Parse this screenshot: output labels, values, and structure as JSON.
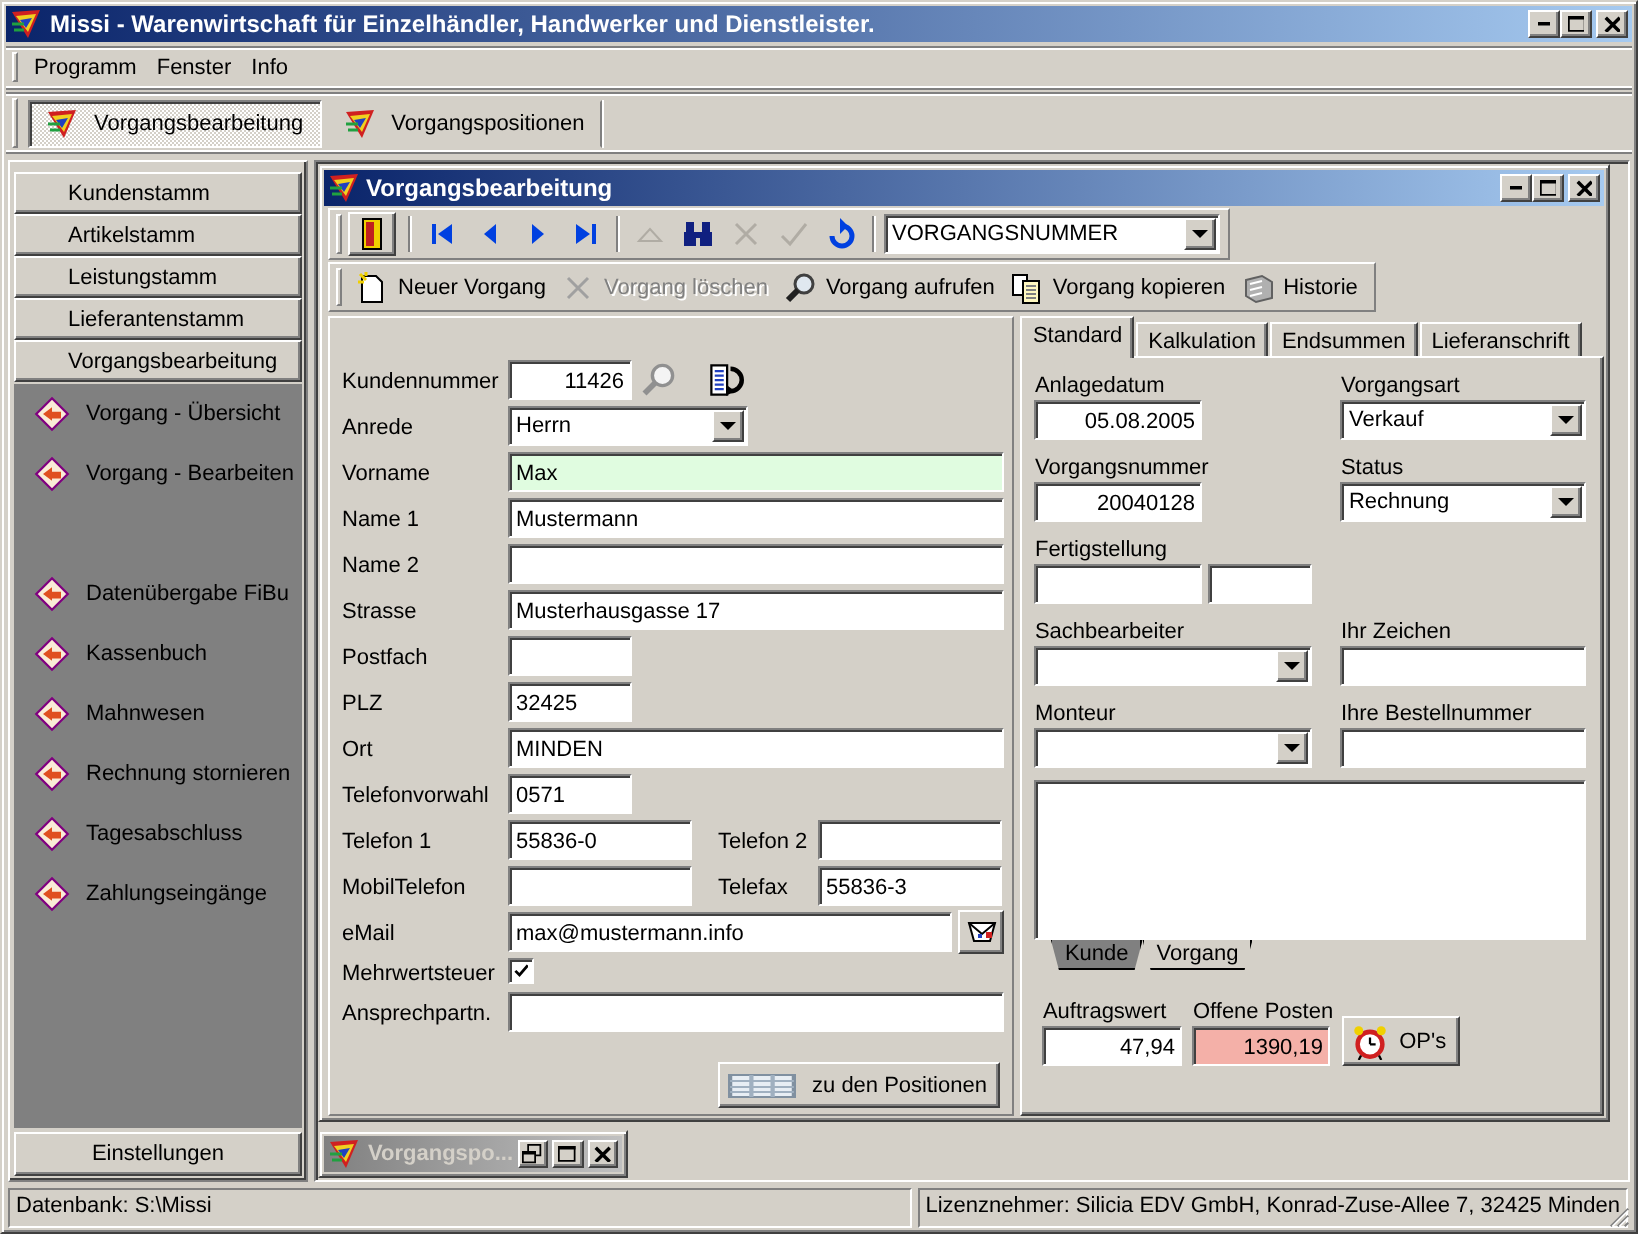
{
  "window": {
    "title": "Missi - Warenwirtschaft für Einzelhändler, Handwerker und Dienstleister."
  },
  "menu": [
    "Programm",
    "Fenster",
    "Info"
  ],
  "toolbar": [
    {
      "label": "Vorgangsbearbeitung",
      "selected": true
    },
    {
      "label": "Vorgangspositionen",
      "selected": false
    }
  ],
  "sidebar": {
    "modules": [
      "Kundenstamm",
      "Artikelstamm",
      "Leistungstamm",
      "Lieferantenstamm",
      "Vorgangsbearbeitung"
    ],
    "task_groups": [
      [
        "Vorgang - Übersicht",
        "Vorgang - Bearbeiten"
      ],
      [
        "Datenübergabe FiBu",
        "Kassenbuch",
        "Mahnwesen",
        "Rechnung stornieren",
        "Tagesabschluss",
        "Zahlungseingänge"
      ]
    ],
    "settings": "Einstellungen"
  },
  "child_window": {
    "title": "Vorgangsbearbeitung",
    "nav_groups": [
      [
        {
          "kind": "exit",
          "disabled": false
        }
      ],
      [
        {
          "kind": "first",
          "disabled": false
        },
        {
          "kind": "prev",
          "disabled": false
        },
        {
          "kind": "next",
          "disabled": false
        },
        {
          "kind": "last",
          "disabled": false
        }
      ],
      [
        {
          "kind": "up",
          "disabled": true
        },
        {
          "kind": "find",
          "disabled": false
        },
        {
          "kind": "cancel",
          "disabled": true
        },
        {
          "kind": "confirm",
          "disabled": true
        },
        {
          "kind": "refresh",
          "disabled": false
        }
      ]
    ],
    "search_field": {
      "value": "VORGANGSNUMMER"
    },
    "actions": [
      {
        "kind": "new",
        "label": "Neuer Vorgang",
        "disabled": false
      },
      {
        "kind": "delete",
        "label": "Vorgang löschen",
        "disabled": true
      },
      {
        "kind": "open",
        "label": "Vorgang aufrufen",
        "disabled": false
      },
      {
        "kind": "copy",
        "label": "Vorgang kopieren",
        "disabled": false
      },
      {
        "kind": "history",
        "label": "Historie",
        "disabled": false
      }
    ],
    "customer_form": {
      "rows": [
        [
          {
            "label": "Kundennummer",
            "kind": "lookup",
            "value": "11426",
            "focused": false
          }
        ],
        [
          {
            "label": "Anrede",
            "kind": "combo",
            "value": "Herrn"
          }
        ],
        [
          {
            "label": "Vorname",
            "kind": "text",
            "value": "Max",
            "focused": true
          }
        ],
        [
          {
            "label": "Name 1",
            "kind": "text",
            "value": "Mustermann",
            "focused": false
          }
        ],
        [
          {
            "label": "Name 2",
            "kind": "text",
            "focused": false
          }
        ],
        [
          {
            "label": "Strasse",
            "kind": "text",
            "value": "Musterhausgasse 17",
            "focused": false
          }
        ],
        [
          {
            "label": "Postfach",
            "kind": "short",
            "focused": false
          }
        ],
        [
          {
            "label": "PLZ",
            "kind": "short",
            "value": "32425",
            "focused": false
          }
        ],
        [
          {
            "label": "Ort",
            "kind": "text",
            "value": "MINDEN",
            "focused": false
          }
        ],
        [
          {
            "label": "Telefonvorwahl",
            "kind": "short",
            "value": "0571",
            "focused": false
          }
        ],
        [
          {
            "label": "Telefon 1",
            "kind": "half",
            "value": "55836-0",
            "focused": false
          },
          {
            "label": "Telefon 2",
            "kind": "half",
            "focused": false
          }
        ],
        [
          {
            "label": "MobilTelefon",
            "kind": "half",
            "focused": false
          },
          {
            "label": "Telefax",
            "kind": "half",
            "value": "55836-3",
            "focused": false
          }
        ],
        [
          {
            "label": "eMail",
            "kind": "email",
            "value": "max@mustermann.info",
            "focused": false
          }
        ],
        [
          {
            "label": "Mehrwertsteuer",
            "kind": "check",
            "checked": true
          }
        ],
        [
          {
            "label": "Ansprechpartn.",
            "kind": "text",
            "focused": false
          }
        ]
      ],
      "positions_button": "zu den Positionen"
    },
    "tabs": [
      {
        "label": "Standard",
        "selected": true
      },
      {
        "label": "Kalkulation",
        "selected": false
      },
      {
        "label": "Endsummen",
        "selected": false
      },
      {
        "label": "Lieferanschrift",
        "selected": false
      }
    ],
    "standard_tab": {
      "rows": [
        [
          {
            "label": "Anlagedatum",
            "kind": "number",
            "value": "05.08.2005"
          },
          {
            "label": "Vorgangsart",
            "kind": "combo",
            "value": "Verkauf"
          }
        ],
        [
          {
            "label": "Vorgangsnummer",
            "kind": "number",
            "value": "20040128"
          },
          {
            "label": "Status",
            "kind": "combo",
            "value": "Rechnung"
          }
        ],
        [
          {
            "label": "Fertigstellung",
            "kind": "pair"
          }
        ],
        [
          {
            "label": "Sachbearbeiter",
            "kind": "combo"
          },
          {
            "label": "Ihr Zeichen",
            "kind": "text"
          }
        ],
        [
          {
            "label": "Monteur",
            "kind": "combo"
          },
          {
            "label": "Ihre Bestellnummer",
            "kind": "text"
          }
        ]
      ],
      "memo_tabs": [
        {
          "label": "Kunde",
          "selected": true
        },
        {
          "label": "Vorgang",
          "selected": false
        }
      ],
      "totals": [
        {
          "label": "Auftragswert",
          "value": "47,94",
          "highlighted": false
        },
        {
          "label": "Offene Posten",
          "value": "1390,19",
          "highlighted": true
        }
      ],
      "op_button": "OP's"
    }
  },
  "minimized_window": {
    "title": "Vorgangspo..."
  },
  "status_bar": [
    "Datenbank: S:\\Missi",
    "Lizenznehmer: Silicia EDV GmbH, Konrad-Zuse-Allee 7, 32425 Minden"
  ]
}
